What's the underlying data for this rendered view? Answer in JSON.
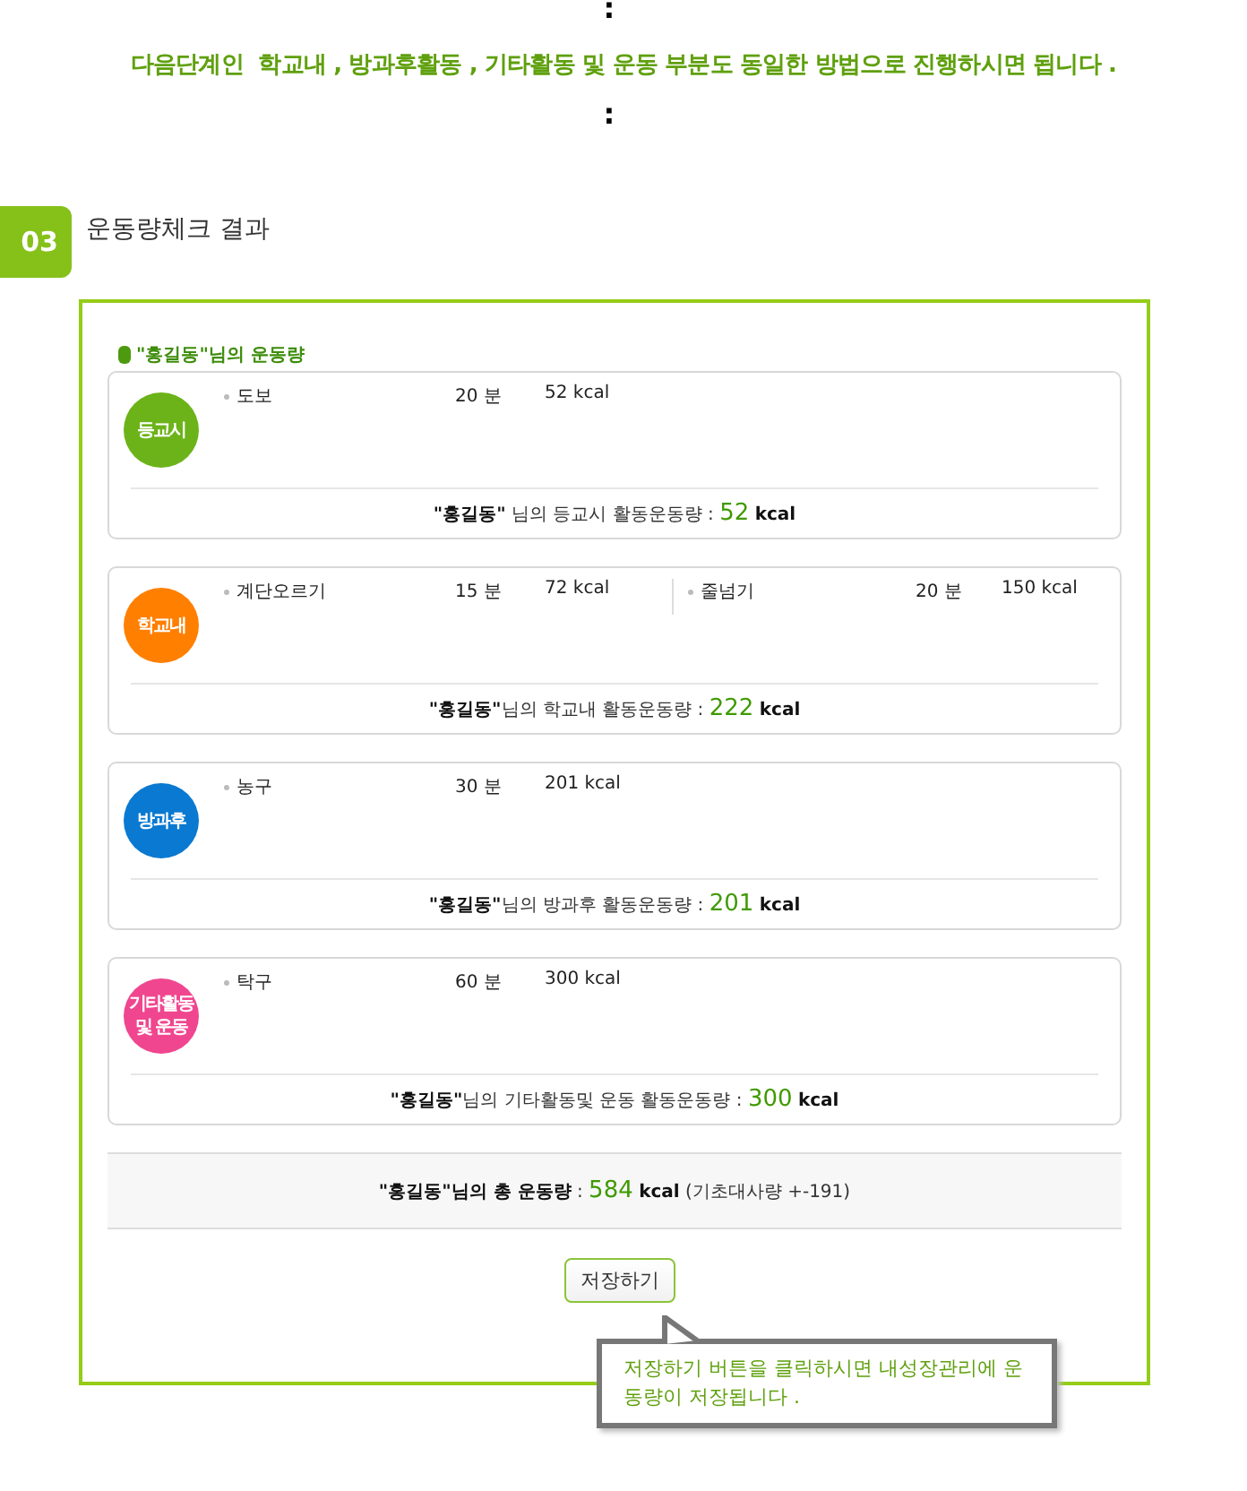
{
  "intro": {
    "dot_top": ":",
    "message": "다음단계인  학교내 , 방과후활동 , 기타활동 및 운동 부분도 동일한 방법으로 진행하시면 됩니다 .",
    "dot_bottom": ":"
  },
  "section": {
    "number": "03",
    "title": "운동량체크 결과"
  },
  "result": {
    "heading": "\"홍길동\"님의 운동량",
    "cards": [
      {
        "badge": "등교시",
        "color": "#6cb31a",
        "activities": [
          {
            "name": "도보",
            "minutes": "20 분",
            "kcal": "52 kcal"
          }
        ],
        "summary": {
          "text": "**\"홍길동\"** 님의 등교시 활동운동량 :",
          "value": "52",
          "unit": "kcal"
        }
      },
      {
        "badge": "학교내",
        "color": "#ff7f00",
        "activities": [
          {
            "name": "계단오르기",
            "minutes": "15 분",
            "kcal": "72 kcal"
          },
          {
            "name": "줄넘기",
            "minutes": "20 분",
            "kcal": "150 kcal"
          }
        ],
        "summary": {
          "text": "**\"홍길동\"**님의 학교내 활동운동량 :",
          "value": "222",
          "unit": "kcal"
        }
      },
      {
        "badge": "방과후",
        "color": "#0a79d1",
        "activities": [
          {
            "name": "농구",
            "minutes": "30 분",
            "kcal": "201 kcal"
          }
        ],
        "summary": {
          "text": "**\"홍길동\"**님의 방과후 활동운동량 :",
          "value": "201",
          "unit": "kcal"
        }
      },
      {
        "badge": "기타활동 및 운동",
        "color": "#f0468f",
        "activities": [
          {
            "name": "탁구",
            "minutes": "60 분",
            "kcal": "300 kcal"
          }
        ],
        "summary": {
          "text": "**\"홍길동\"**님의 기타활동및 운동 활동운동량 :",
          "value": "300",
          "unit": "kcal"
        }
      }
    ],
    "total": {
      "text": "**\"홍길동\"님의 총 운동량** :",
      "value": "584",
      "unit": "kcal",
      "note": "(기초대사량 +-191)"
    },
    "save_button": "저장하기",
    "tooltip": "저장하기 버튼을 클릭하시면 내성장관리에 운동량이 저장됩니다 ."
  }
}
